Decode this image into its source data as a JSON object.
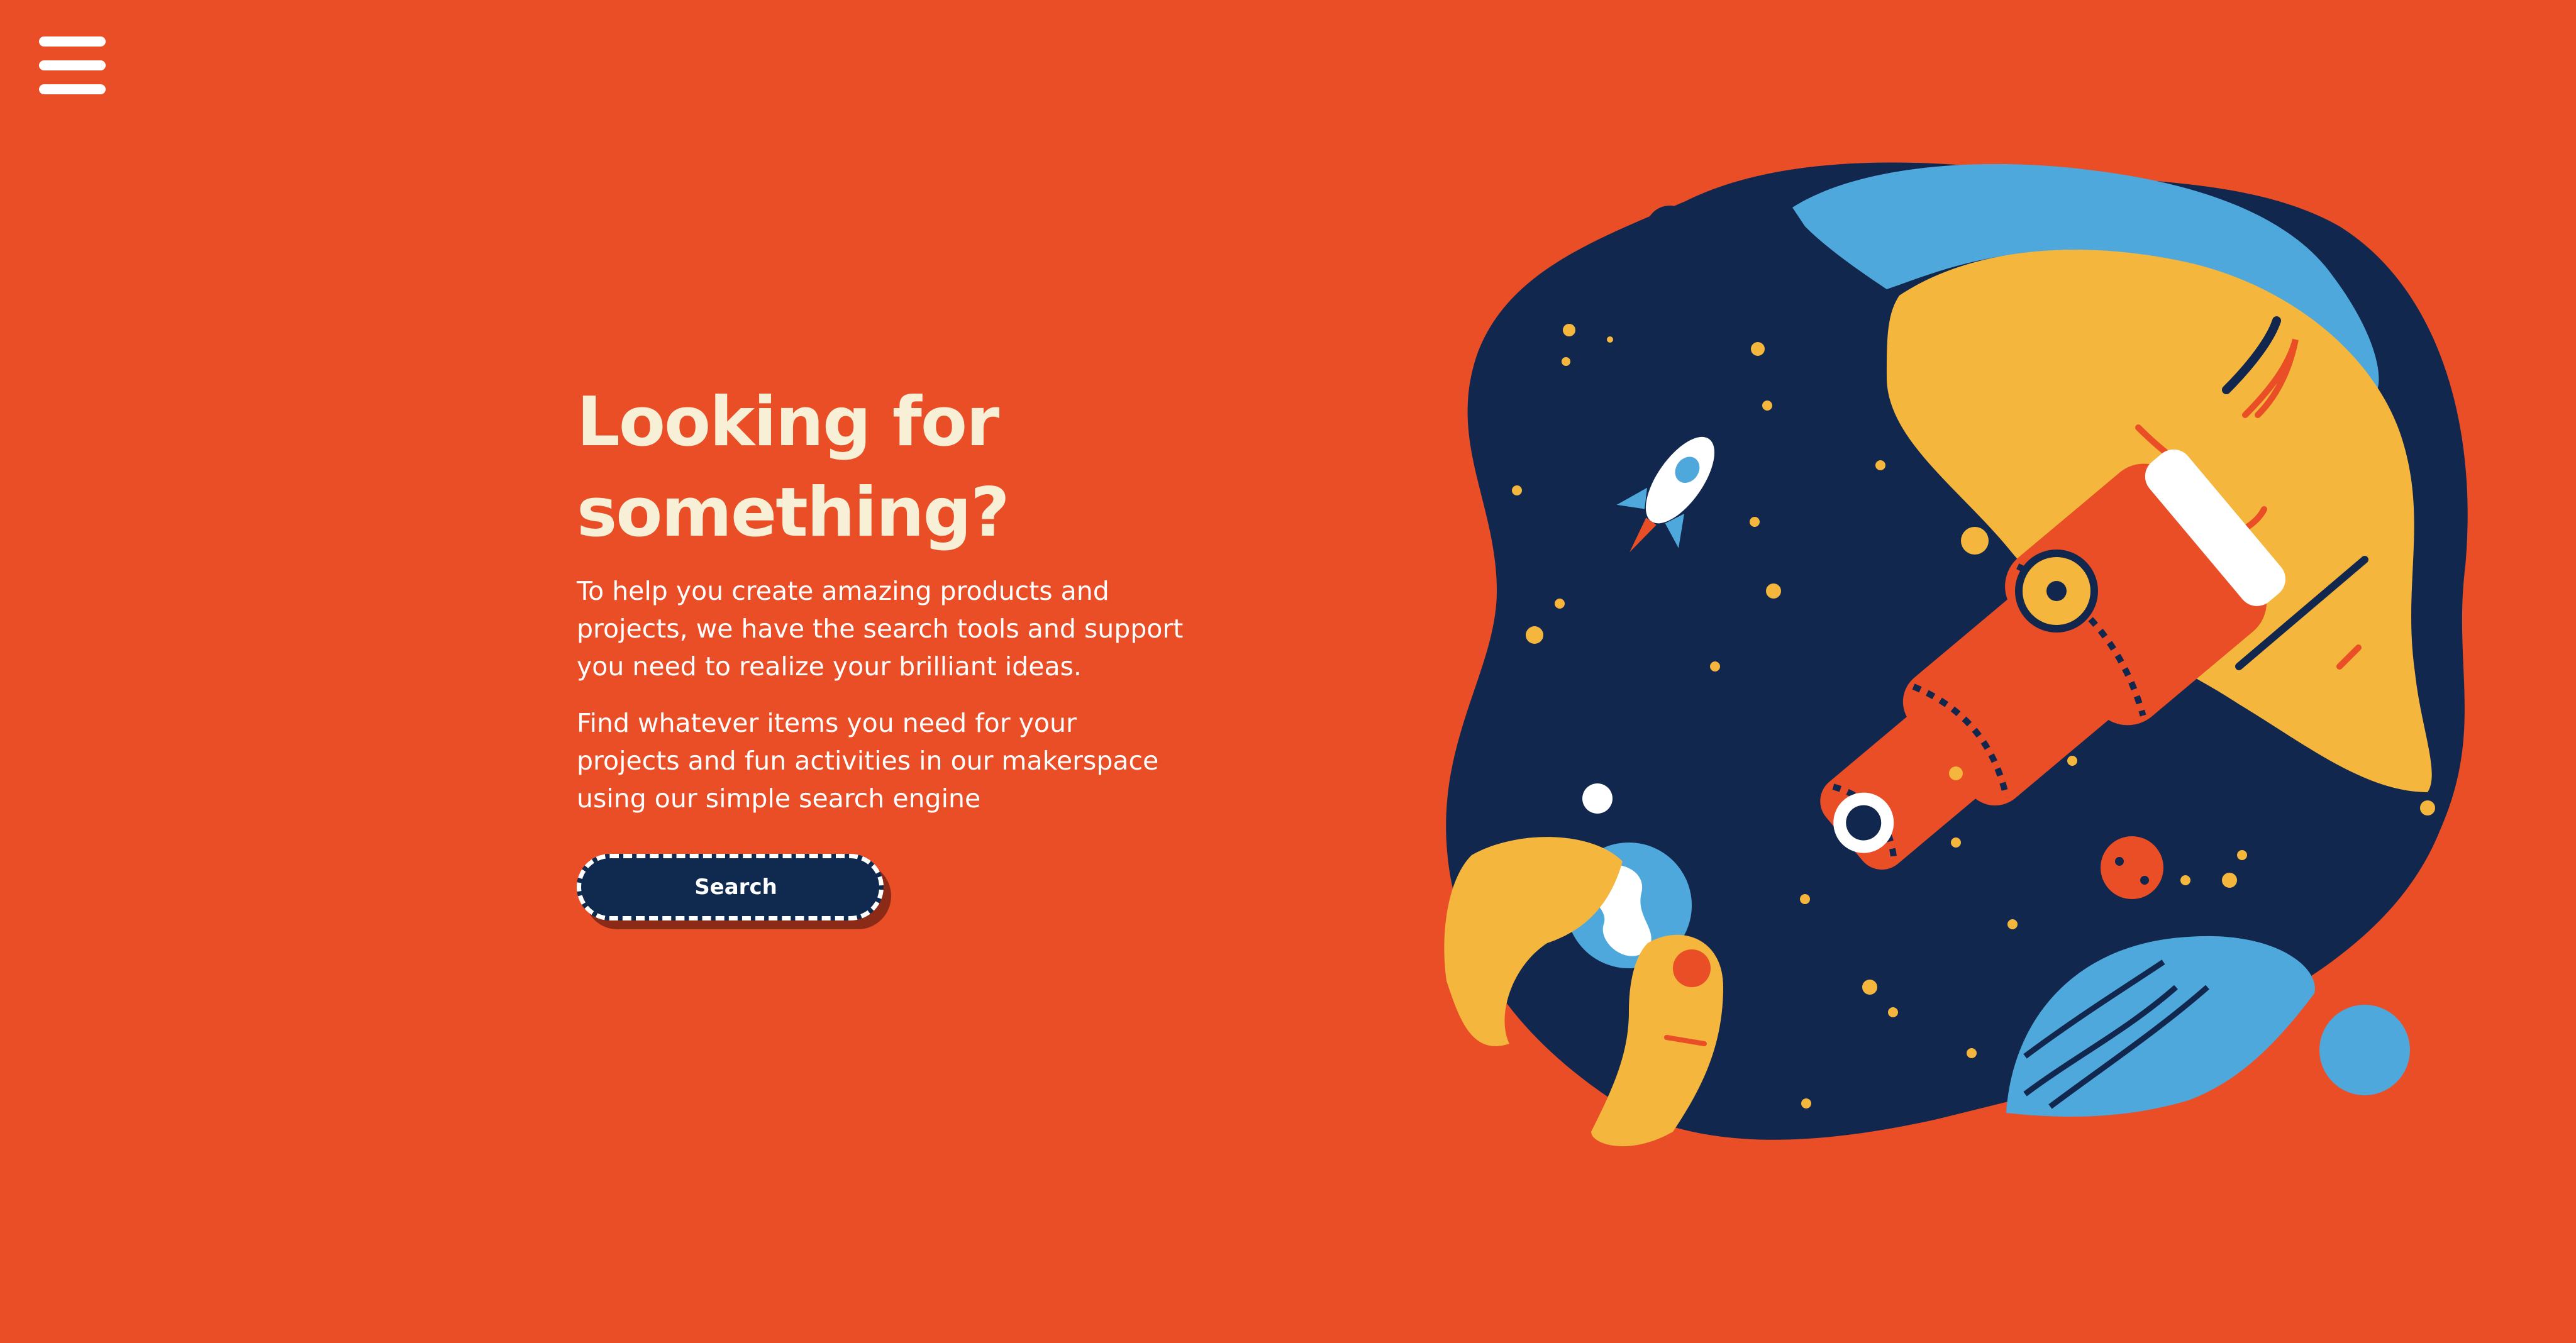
{
  "menu": {
    "icon": "hamburger-menu-icon"
  },
  "hero": {
    "title": "Looking for\nsomething?",
    "paragraph_1": "To help you create amazing products and projects, we have the search tools and support you need to realize your brilliant ideas.",
    "paragraph_2": "Find whatever items you need for your projects and fun activities in our makerspace using our simple search engine",
    "search_button_label": "Search"
  },
  "colors": {
    "background": "#e94e27",
    "title": "#f7efd6",
    "button": "#0f2a4e",
    "navy": "#12274d",
    "yellow": "#f4b63c",
    "blue": "#4fa8dc"
  },
  "illustration": {
    "icon": "astronomer-telescope-illustration"
  }
}
